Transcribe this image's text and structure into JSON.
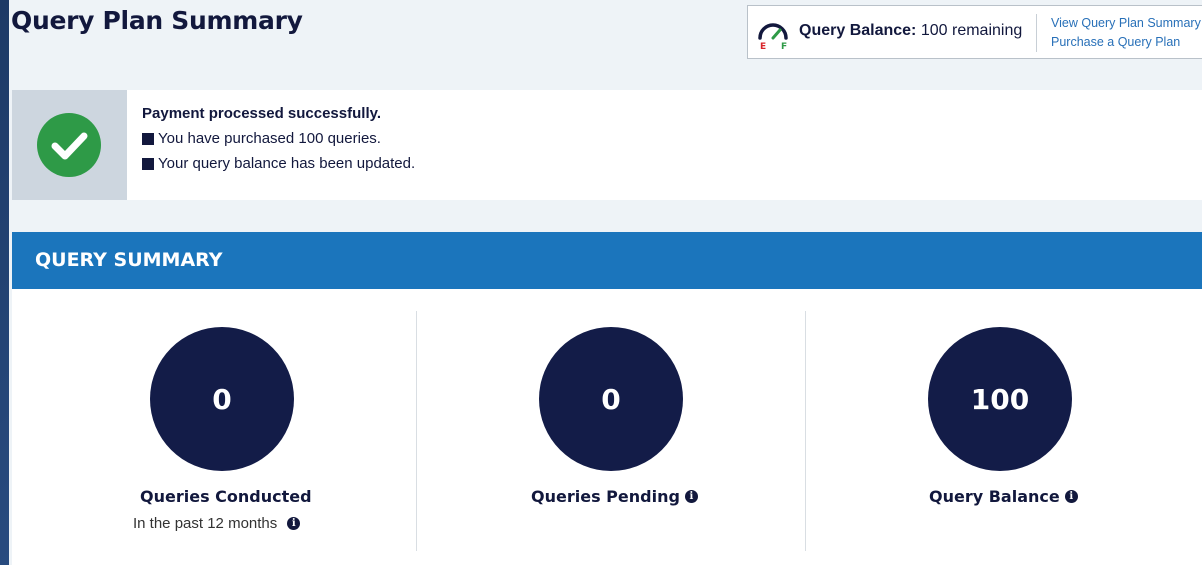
{
  "page": {
    "title": "Query Plan Summary"
  },
  "balance_widget": {
    "gauge_icon": "fuel-gauge-icon",
    "gauge_empty_label": "E",
    "gauge_full_label": "F",
    "label": "Query Balance:",
    "value": "100 remaining",
    "links": [
      "View Query Plan Summary",
      "Purchase a Query Plan"
    ]
  },
  "alert": {
    "icon": "check-circle-icon",
    "title": "Payment processed successfully.",
    "lines": [
      "You have purchased 100 queries.",
      "Your query balance has been updated."
    ]
  },
  "summary": {
    "header": "QUERY SUMMARY",
    "stats": [
      {
        "value": "0",
        "label": "Queries Conducted",
        "sub": "In the past 12 months",
        "info": "i"
      },
      {
        "value": "0",
        "label": "Queries Pending",
        "info": "i"
      },
      {
        "value": "100",
        "label": "Query Balance",
        "info": "i"
      }
    ]
  },
  "colors": {
    "brand_blue": "#1b75bc",
    "navy": "#131c48",
    "success_green": "#2e9a47",
    "link_blue": "#2870b8"
  }
}
